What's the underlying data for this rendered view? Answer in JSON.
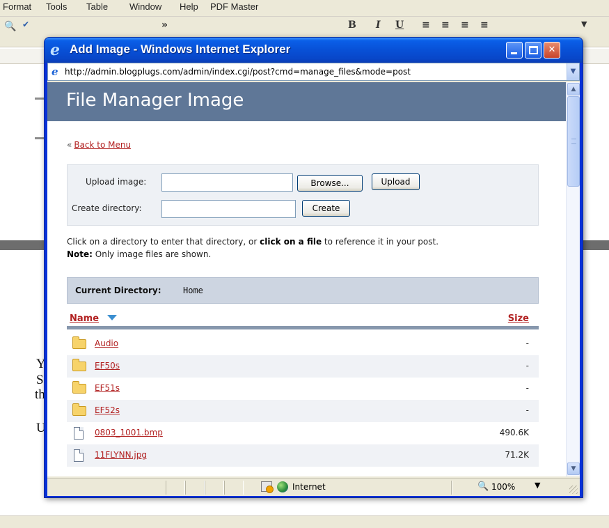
{
  "host_app": {
    "menu": [
      {
        "label": "Format",
        "mnemonic": "o"
      },
      {
        "label": "Tools",
        "mnemonic": "T"
      },
      {
        "label": "Table",
        "mnemonic": "a"
      },
      {
        "label": "Window",
        "mnemonic": "W"
      },
      {
        "label": "Help",
        "mnemonic": "H"
      },
      {
        "label": "PDF Master",
        "mnemonic": ""
      }
    ],
    "doc_fragments": [
      "Y",
      "S",
      "th",
      "U"
    ]
  },
  "window": {
    "title": "Add Image - Windows Internet Explorer",
    "address_url": "http://admin.blogplugs.com/admin/index.cgi/post?cmd=manage_files&mode=post"
  },
  "page": {
    "header_title": "File Manager Image",
    "back_link": "Back to Menu",
    "upload": {
      "upload_label": "Upload image:",
      "upload_value": "",
      "browse_button": "Browse...",
      "upload_button": "Upload",
      "create_dir_label": "Create directory:",
      "create_dir_value": "",
      "create_button": "Create"
    },
    "instructions": {
      "part1": "Click on a directory to enter that directory, or ",
      "bold": "click on a file",
      "part2": " to reference it in your post.",
      "note_label": "Note:",
      "note_text": " Only image files are shown."
    },
    "current_directory": {
      "label": "Current Directory:",
      "value": "Home"
    },
    "table": {
      "name_header": "Name",
      "size_header": "Size",
      "rows": [
        {
          "type": "folder",
          "name": "Audio",
          "size": "-"
        },
        {
          "type": "folder",
          "name": "EF50s",
          "size": "-"
        },
        {
          "type": "folder",
          "name": "EF51s",
          "size": "-"
        },
        {
          "type": "folder",
          "name": "EF52s",
          "size": "-"
        },
        {
          "type": "file",
          "name": "0803_1001.bmp",
          "size": "490.6K"
        },
        {
          "type": "file",
          "name": "11FLYNN.jpg",
          "size": "71.2K"
        }
      ]
    }
  },
  "statusbar": {
    "zone": "Internet",
    "zoom": "100%"
  },
  "colors": {
    "title_bar": "#0850d6",
    "page_header": "#5f7797",
    "link": "#b22222",
    "dir_bar": "#cdd5e1"
  }
}
